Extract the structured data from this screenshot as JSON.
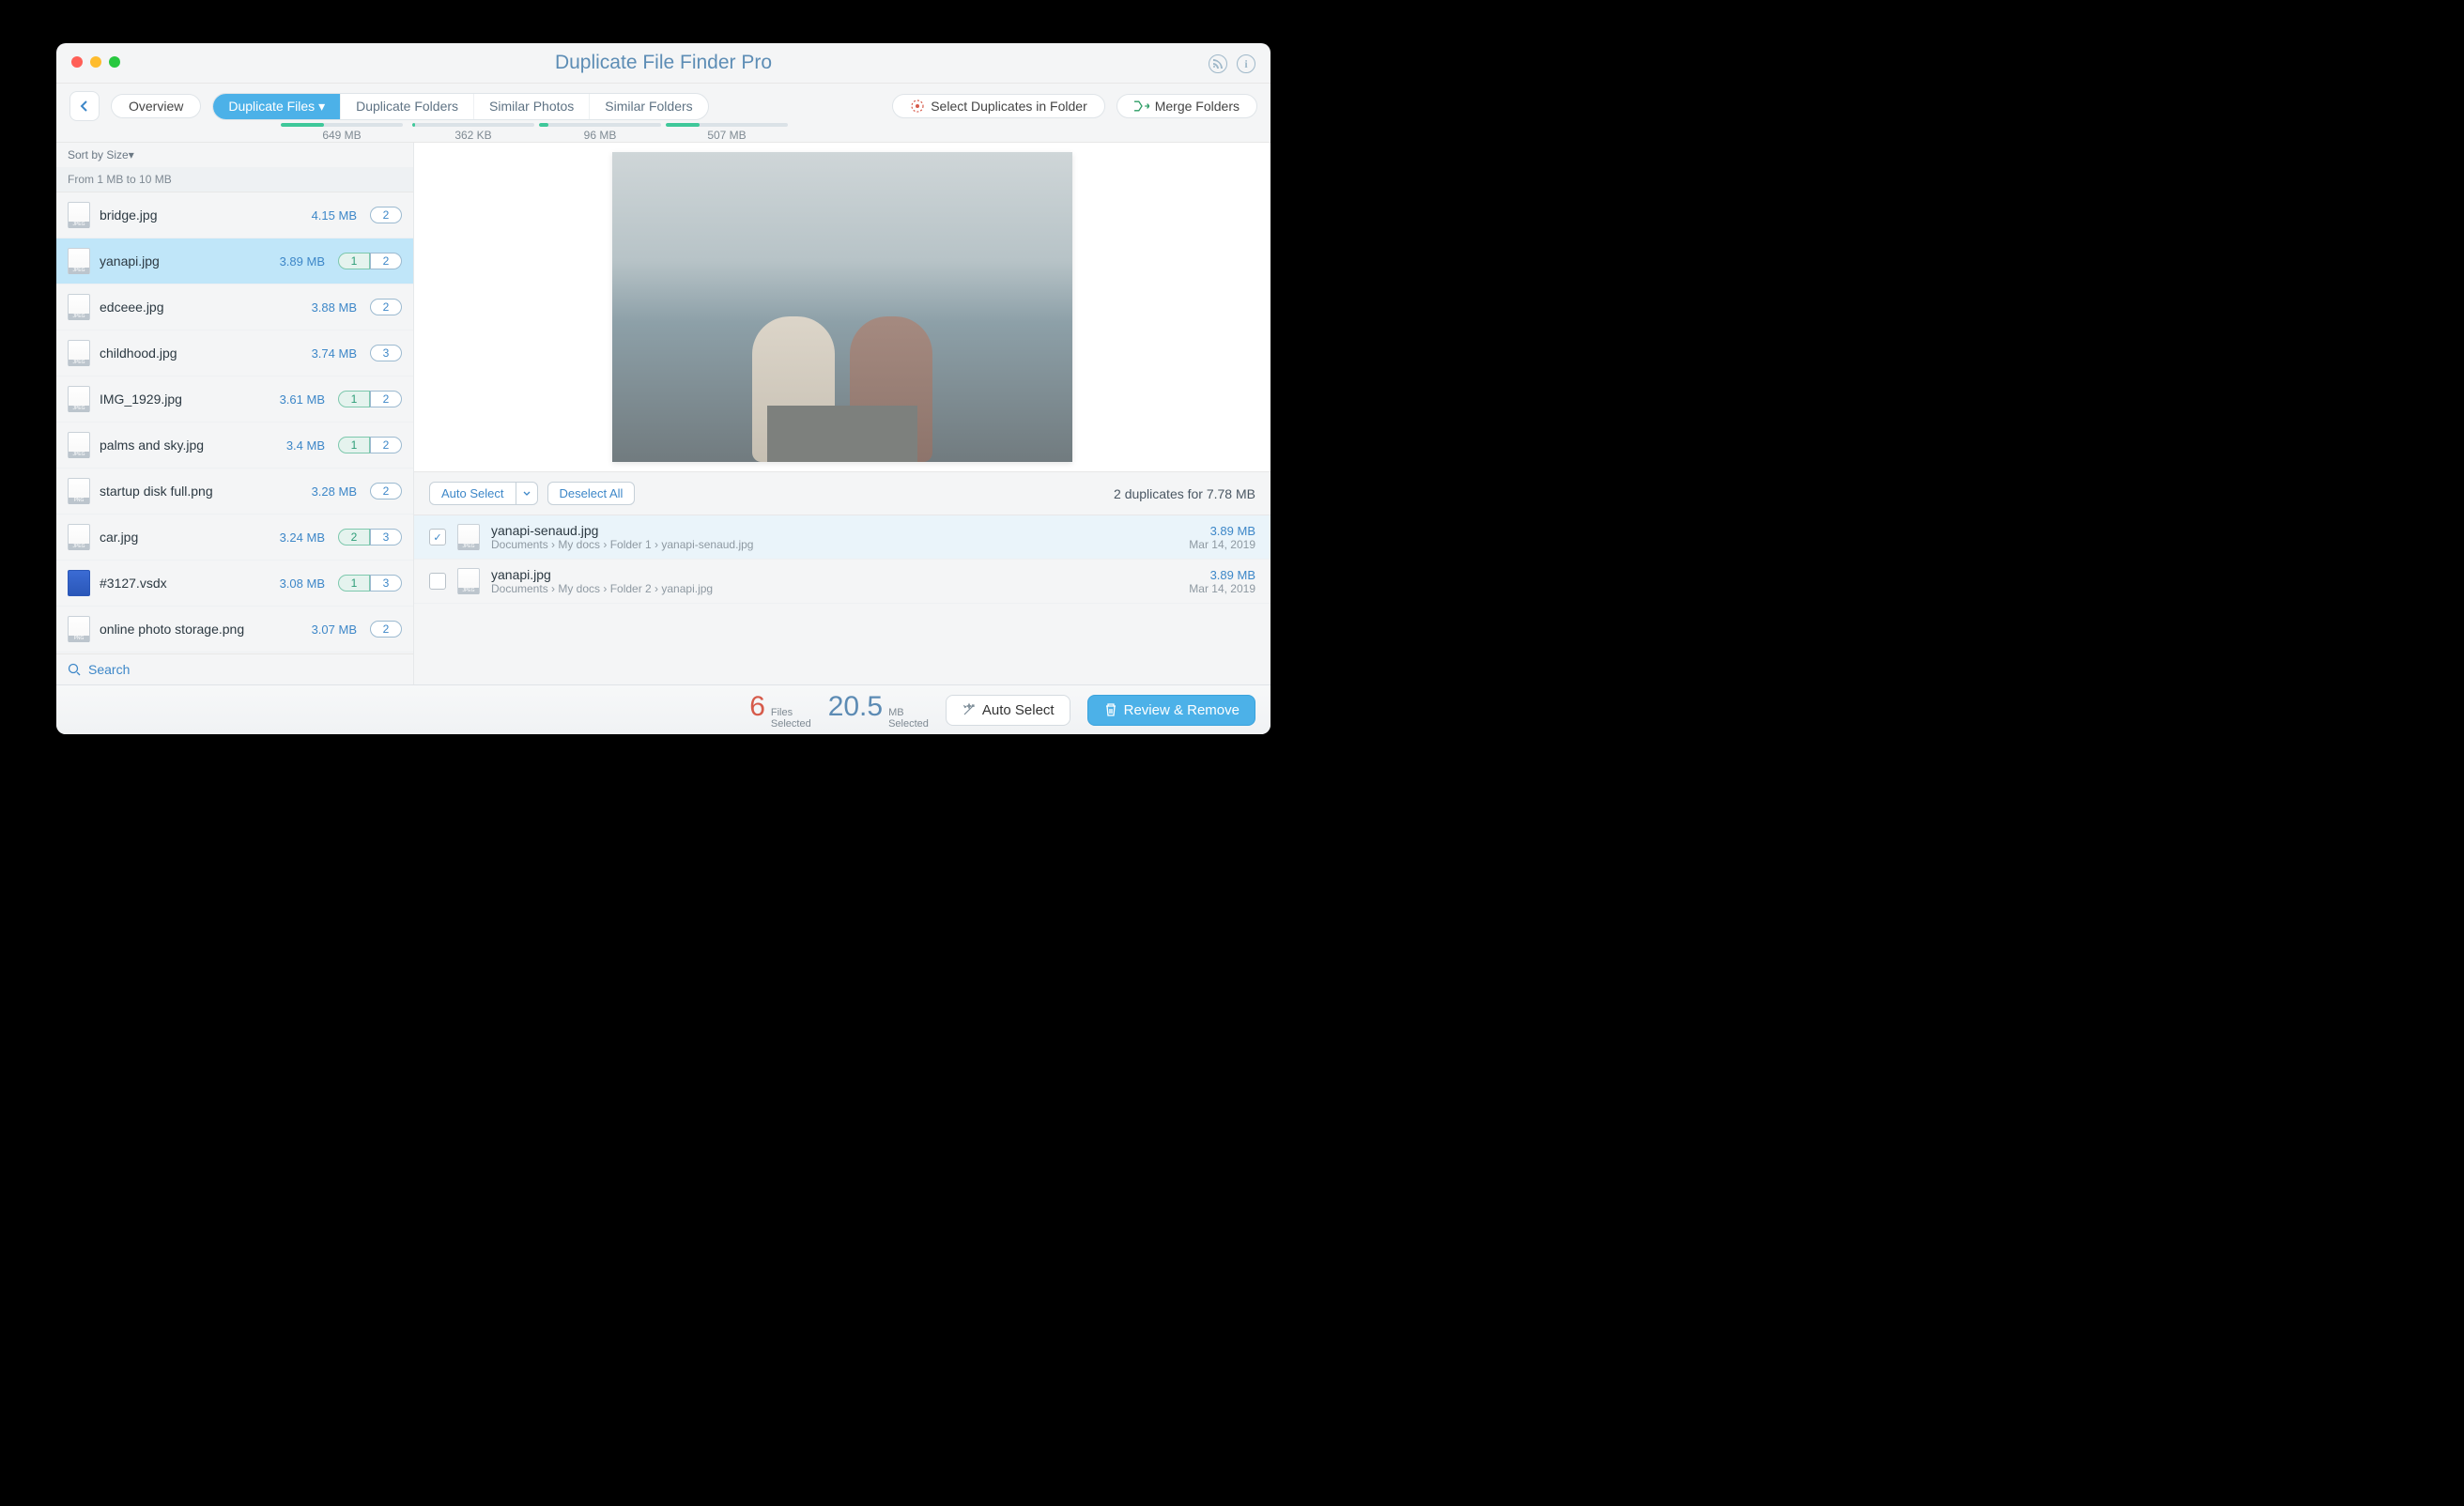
{
  "title": "Duplicate File Finder Pro",
  "toolbar": {
    "overview": "Overview",
    "tabs": [
      {
        "label": "Duplicate Files",
        "size": "649 MB",
        "fill": 35,
        "active": true
      },
      {
        "label": "Duplicate Folders",
        "size": "362 KB",
        "fill": 2,
        "active": false
      },
      {
        "label": "Similar Photos",
        "size": "96 MB",
        "fill": 8,
        "active": false
      },
      {
        "label": "Similar Folders",
        "size": "507 MB",
        "fill": 28,
        "active": false
      }
    ],
    "select_dupes": "Select Duplicates in Folder",
    "merge": "Merge Folders"
  },
  "sidebar": {
    "sort": "Sort by Size",
    "sort_caret": "▾",
    "range": "From 1 MB to 10 MB",
    "search": "Search",
    "items": [
      {
        "name": "bridge.jpg",
        "size": "4.15 MB",
        "type": "jpg",
        "badges": [
          "2"
        ],
        "sel": [
          false
        ],
        "selected": false
      },
      {
        "name": "yanapi.jpg",
        "size": "3.89 MB",
        "type": "jpg",
        "badges": [
          "1",
          "2"
        ],
        "sel": [
          true,
          false
        ],
        "selected": true
      },
      {
        "name": "edceee.jpg",
        "size": "3.88 MB",
        "type": "jpg",
        "badges": [
          "2"
        ],
        "sel": [
          false
        ],
        "selected": false
      },
      {
        "name": "childhood.jpg",
        "size": "3.74 MB",
        "type": "jpg",
        "badges": [
          "3"
        ],
        "sel": [
          false
        ],
        "selected": false
      },
      {
        "name": "IMG_1929.jpg",
        "size": "3.61 MB",
        "type": "jpg",
        "badges": [
          "1",
          "2"
        ],
        "sel": [
          true,
          false
        ],
        "selected": false
      },
      {
        "name": "palms and sky.jpg",
        "size": "3.4 MB",
        "type": "jpg",
        "badges": [
          "1",
          "2"
        ],
        "sel": [
          true,
          false
        ],
        "selected": false
      },
      {
        "name": "startup disk full.png",
        "size": "3.28 MB",
        "type": "png",
        "badges": [
          "2"
        ],
        "sel": [
          false
        ],
        "selected": false
      },
      {
        "name": "car.jpg",
        "size": "3.24 MB",
        "type": "jpg",
        "badges": [
          "2",
          "3"
        ],
        "sel": [
          true,
          false
        ],
        "selected": false
      },
      {
        "name": "#3127.vsdx",
        "size": "3.08 MB",
        "type": "vsdx",
        "badges": [
          "1",
          "3"
        ],
        "sel": [
          true,
          false
        ],
        "selected": false
      },
      {
        "name": "online photo storage.png",
        "size": "3.07 MB",
        "type": "png",
        "badges": [
          "2"
        ],
        "sel": [
          false
        ],
        "selected": false
      }
    ]
  },
  "detail": {
    "auto_select": "Auto Select",
    "deselect": "Deselect All",
    "summary": "2 duplicates for 7.78 MB",
    "rows": [
      {
        "checked": true,
        "name": "yanapi-senaud.jpg",
        "path": "Documents  ›  My docs  ›  Folder 1  ›  yanapi-senaud.jpg",
        "size": "3.89 MB",
        "date": "Mar 14, 2019",
        "selected": true
      },
      {
        "checked": false,
        "name": "yanapi.jpg",
        "path": "Documents  ›  My docs  ›  Folder 2  ›  yanapi.jpg",
        "size": "3.89 MB",
        "date": "Mar 14, 2019",
        "selected": false
      }
    ]
  },
  "footer": {
    "count": "6",
    "count_label1": "Files",
    "count_label2": "Selected",
    "mb": "20.5",
    "mb_label1": "MB",
    "mb_label2": "Selected",
    "auto": "Auto Select",
    "review": "Review & Remove"
  }
}
